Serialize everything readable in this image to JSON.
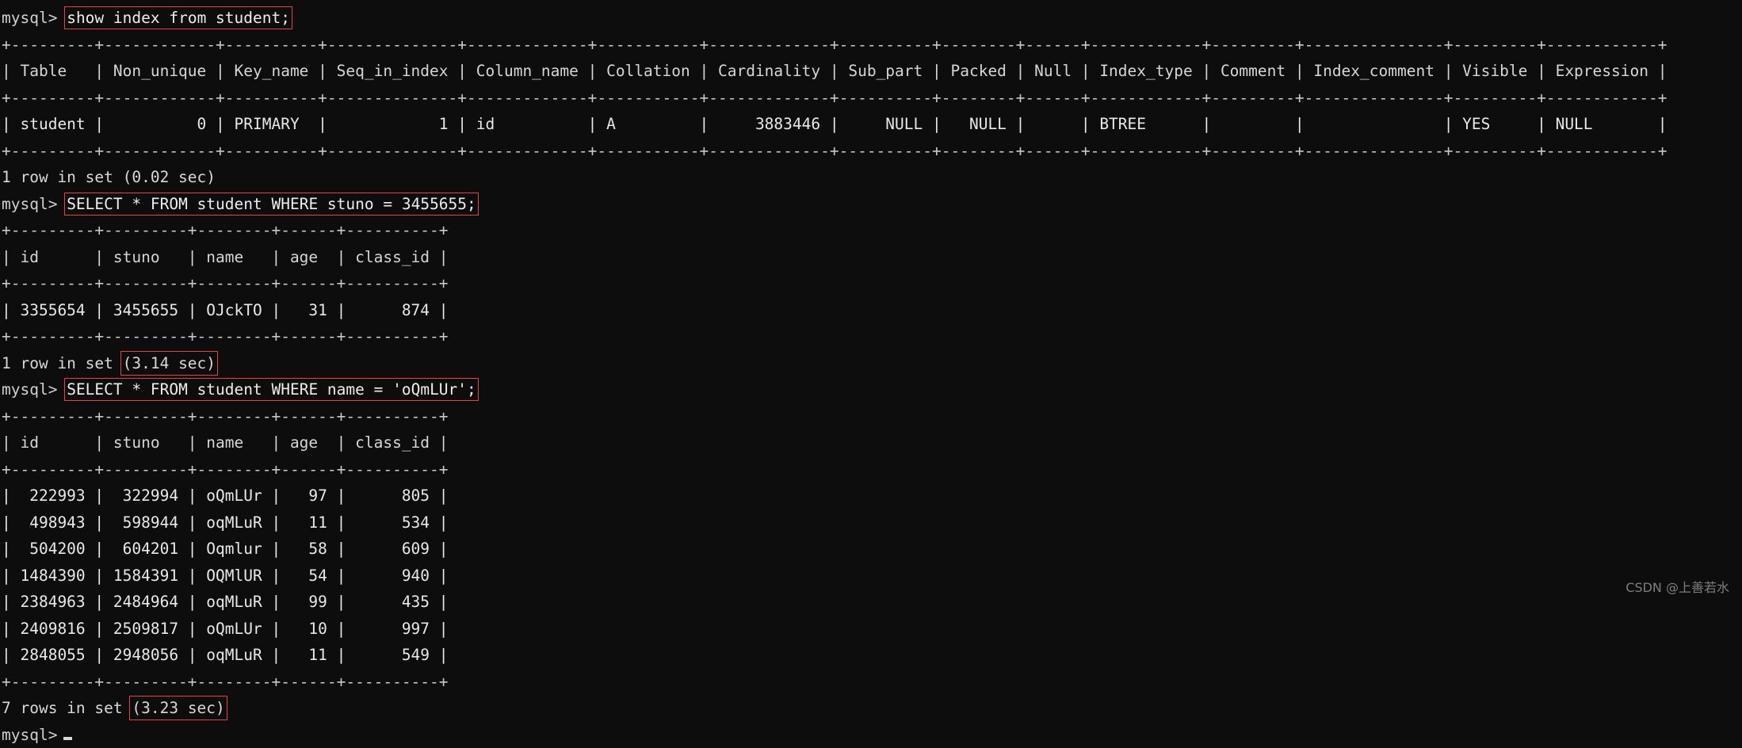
{
  "terminal": {
    "prompt": "mysql>",
    "colors": {
      "background": "#0d0d0d",
      "foreground": "#d8d8d8",
      "highlight_box": "#e8413d",
      "watermark": "#7e7e7e"
    },
    "watermark": "CSDN @上善若水"
  },
  "blocks": [
    {
      "id": "block-1",
      "prompt": "mysql>",
      "command": "show index from student;",
      "command_highlighted": true,
      "table": {
        "top_rule": "+---------+------------+----------+--------------+-------------+-----------+-------------+----------+--------+------+------------+---------+---------------+---------+------------+",
        "header_rule": "+---------+------------+----------+--------------+-------------+-----------+-------------+----------+--------+------+------------+---------+---------------+---------+------------+",
        "bottom_rule": "+---------+------------+----------+--------------+-------------+-----------+-------------+----------+--------+------+------------+---------+---------------+---------+------------+",
        "columns": [
          "Table",
          "Non_unique",
          "Key_name",
          "Seq_in_index",
          "Column_name",
          "Collation",
          "Cardinality",
          "Sub_part",
          "Packed",
          "Null",
          "Index_type",
          "Comment",
          "Index_comment",
          "Visible",
          "Expression"
        ],
        "header_line": "| Table   | Non_unique | Key_name | Seq_in_index | Column_name | Collation | Cardinality | Sub_part | Packed | Null | Index_type | Comment | Index_comment | Visible | Expression |",
        "rows": [
          "| student |          0 | PRIMARY  |            1 | id          | A         |     3883446 |     NULL |   NULL |      | BTREE      |         |               | YES     | NULL       |"
        ],
        "row_values": [
          [
            "student",
            "0",
            "PRIMARY",
            "1",
            "id",
            "A",
            "3883446",
            "NULL",
            "NULL",
            "",
            "BTREE",
            "",
            "",
            "YES",
            "NULL"
          ]
        ]
      },
      "status": "1 row in set (0.02 sec)",
      "status_highlighted": false
    },
    {
      "id": "block-2",
      "prompt": "mysql>",
      "command": "SELECT * FROM student WHERE stuno = 3455655;",
      "command_highlighted": true,
      "table": {
        "top_rule": "+---------+---------+--------+------+----------+",
        "header_rule": "+---------+---------+--------+------+----------+",
        "bottom_rule": "+---------+---------+--------+------+----------+",
        "columns": [
          "id",
          "stuno",
          "name",
          "age",
          "class_id"
        ],
        "header_line": "| id      | stuno   | name   | age  | class_id |",
        "rows": [
          "| 3355654 | 3455655 | OJckTO |   31 |      874 |"
        ],
        "row_values": [
          [
            "3355654",
            "3455655",
            "OJckTO",
            "31",
            "874"
          ]
        ]
      },
      "status_prefix": "1 row in set ",
      "status_time": "(3.14 sec)",
      "status": "1 row in set (3.14 sec)",
      "status_highlighted": true
    },
    {
      "id": "block-3",
      "prompt": "mysql>",
      "command": "SELECT * FROM student WHERE name = 'oQmLUr';",
      "command_highlighted": true,
      "table": {
        "top_rule": "+---------+---------+--------+------+----------+",
        "header_rule": "+---------+---------+--------+------+----------+",
        "bottom_rule": "+---------+---------+--------+------+----------+",
        "columns": [
          "id",
          "stuno",
          "name",
          "age",
          "class_id"
        ],
        "header_line": "| id      | stuno   | name   | age  | class_id |",
        "rows": [
          "|  222993 |  322994 | oQmLUr |   97 |      805 |",
          "|  498943 |  598944 | oqMLuR |   11 |      534 |",
          "|  504200 |  604201 | Oqmlur |   58 |      609 |",
          "| 1484390 | 1584391 | OQMlUR |   54 |      940 |",
          "| 2384963 | 2484964 | oqMLuR |   99 |      435 |",
          "| 2409816 | 2509817 | oQmLUr |   10 |      997 |",
          "| 2848055 | 2948056 | oqMLuR |   11 |      549 |"
        ],
        "row_values": [
          [
            "222993",
            "322994",
            "oQmLUr",
            "97",
            "805"
          ],
          [
            "498943",
            "598944",
            "oqMLuR",
            "11",
            "534"
          ],
          [
            "504200",
            "604201",
            "Oqmlur",
            "58",
            "609"
          ],
          [
            "1484390",
            "1584391",
            "OQMlUR",
            "54",
            "940"
          ],
          [
            "2384963",
            "2484964",
            "oqMLuR",
            "99",
            "435"
          ],
          [
            "2409816",
            "2509817",
            "oQmLUr",
            "10",
            "997"
          ],
          [
            "2848055",
            "2948056",
            "oqMLuR",
            "11",
            "549"
          ]
        ]
      },
      "status_prefix": "7 rows in set ",
      "status_time": "(3.23 sec)",
      "status": "7 rows in set (3.23 sec)",
      "status_highlighted": true
    }
  ],
  "final_prompt": {
    "prompt": "mysql>",
    "cursor": "block"
  }
}
